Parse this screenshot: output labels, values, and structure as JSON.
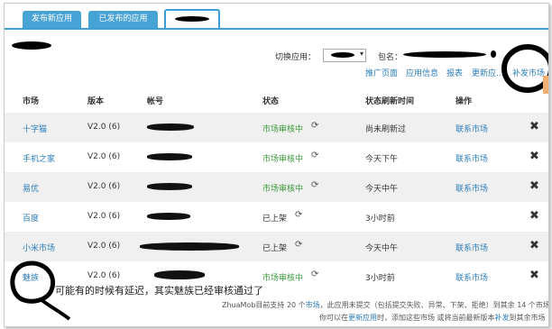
{
  "tabs": [
    {
      "label": "发布新应用"
    },
    {
      "label": "已发布的应用"
    },
    {
      "label": ""
    }
  ],
  "toolbar": {
    "switch_app_label": "切换应用：",
    "package_label": "包名：",
    "links": [
      "推广页面",
      "应用信息",
      "报表",
      "更新应...",
      "补发市场"
    ]
  },
  "table": {
    "headers": [
      "市场",
      "版本",
      "帐号",
      "状态",
      "状态刷新时间",
      "操作"
    ],
    "rows": [
      {
        "market": "十字猫",
        "version": "V2.0 (6)",
        "status": "市场审核中",
        "status_color": "#3a9a3a",
        "time": "尚未刷新过",
        "action": "联系市场"
      },
      {
        "market": "手机之家",
        "version": "V2.0 (6)",
        "status": "市场审核中",
        "status_color": "#3a9a3a",
        "time": "今天下午",
        "action": "联系市场"
      },
      {
        "market": "易优",
        "version": "V2.0 (6)",
        "status": "市场审核中",
        "status_color": "#3a9a3a",
        "time": "今天中午",
        "action": "联系市场"
      },
      {
        "market": "百度",
        "version": "V2.0 (6)",
        "status": "已上架",
        "status_color": "#333333",
        "time": "3小时前",
        "action": ""
      },
      {
        "market": "小米市场",
        "version": "V2.0 (6)",
        "status": "已上架",
        "status_color": "#333333",
        "time": "今天中午",
        "action": "联系市场"
      },
      {
        "market": "魅族",
        "version": "V2.0 (6)",
        "status": "市场审核中",
        "status_color": "#3a9a3a",
        "time": "3小时前",
        "action": "联系市场"
      }
    ]
  },
  "footer": {
    "line1_prefix": "ZhuaMob目前支持 20 个",
    "line1_link1": "市场",
    "line1_mid": "，此应用未提交（包括提交失败、异常、下架、拒绝）到其余 14 个市场",
    "line2_prefix": "你可以在",
    "line2_link1": "更新应用",
    "line2_mid": "时，添加这些市场 或将当前最新版本",
    "line2_link2": "补发",
    "line2_suffix": "到其余市场"
  },
  "annotation": "可能有的时候有延迟，其实魅族已经审核通过了",
  "colors": {
    "tab_blue": "#47a3d6",
    "link": "#2b7db8",
    "green": "#3a9a3a"
  }
}
